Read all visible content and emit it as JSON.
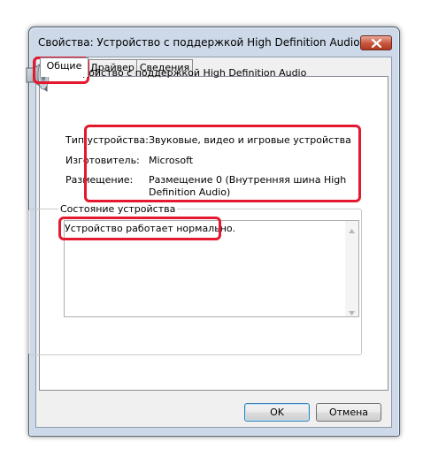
{
  "window": {
    "title": "Свойства: Устройство с поддержкой High Definition Audio"
  },
  "tabs": [
    {
      "label": "Общие",
      "active": true
    },
    {
      "label": "Драйвер",
      "active": false
    },
    {
      "label": "Сведения",
      "active": false
    }
  ],
  "device": {
    "icon": "speaker-icon",
    "name": "Устройство с поддержкой High Definition Audio"
  },
  "properties": [
    {
      "label": "Тип устройства:",
      "value": "Звуковые, видео и игровые устройства"
    },
    {
      "label": "Изготовитель:",
      "value": "Microsoft"
    },
    {
      "label": "Размещение:",
      "value_line1": "Размещение 0 (Внутренняя шина High",
      "value_line2": "Definition Audio)"
    }
  ],
  "status": {
    "group_title": "Состояние устройства",
    "text": "Устройство работает нормально."
  },
  "buttons": {
    "ok": "OK",
    "cancel": "Отмена"
  },
  "colors": {
    "highlight": "#e4192f",
    "window_frame": "#cdd9e8",
    "close_button": "#c8553c"
  }
}
